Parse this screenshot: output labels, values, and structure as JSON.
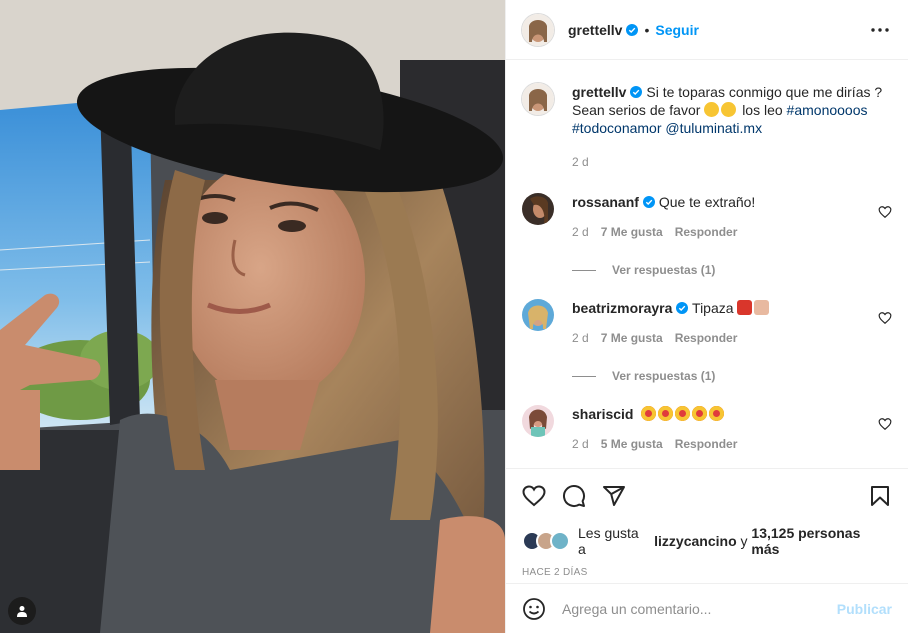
{
  "header": {
    "username": "grettellv",
    "dot": "•",
    "follow_label": "Seguir"
  },
  "caption": {
    "username": "grettellv",
    "text_1": "Si te toparas conmigo que me dirías ? Sean serios de favor",
    "text_2": "los leo",
    "hashtag_1": "#amonoooos",
    "hashtag_2": "#todoconamor",
    "mention": "@tuluminati.mx",
    "time": "2 d"
  },
  "comments": [
    {
      "username": "rossananf",
      "text": "Que te extraño!",
      "time": "2 d",
      "likes": "7 Me gusta",
      "reply_label": "Responder",
      "view_replies": "Ver respuestas (1)"
    },
    {
      "username": "beatrizmorayra",
      "text": "Tipaza",
      "time": "2 d",
      "likes": "7 Me gusta",
      "reply_label": "Responder",
      "view_replies": "Ver respuestas (1)"
    },
    {
      "username": "shariscid",
      "text": "",
      "time": "2 d",
      "likes": "5 Me gusta",
      "reply_label": "Responder"
    }
  ],
  "likes": {
    "prefix": "Les gusta a",
    "user": "lizzycancino",
    "middle": "y",
    "count": "13,125 personas más"
  },
  "date_label": "HACE 2 DÍAS",
  "comment_box": {
    "placeholder": "Agrega un comentario...",
    "publish_label": "Publicar"
  },
  "colors": {
    "accent": "#0095f6",
    "link": "#00376b",
    "muted": "#8e8e8e",
    "verified": "#0095f6"
  }
}
